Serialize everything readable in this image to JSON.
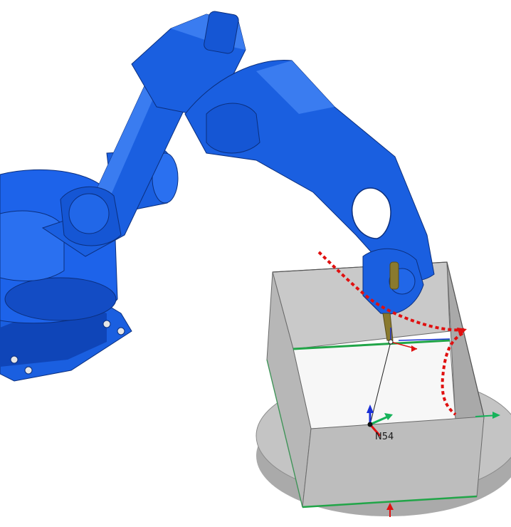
{
  "scene": {
    "robot_color": "#1a5fe0",
    "robot_dark": "#0b3a9e",
    "robot_light": "#3a7cf0",
    "box_wall": "#b9b9b9",
    "box_wall_dark": "#9e9e9e",
    "box_floor": "#f4f4f4",
    "turntable": "#bdbdbd",
    "path_color": "#e01010",
    "tool_color": "#8a7a2e"
  },
  "frame": {
    "label": "N54",
    "axis_x_color": "#e01010",
    "axis_y_color": "#16b35a",
    "axis_z_color": "#1a2fd6"
  }
}
